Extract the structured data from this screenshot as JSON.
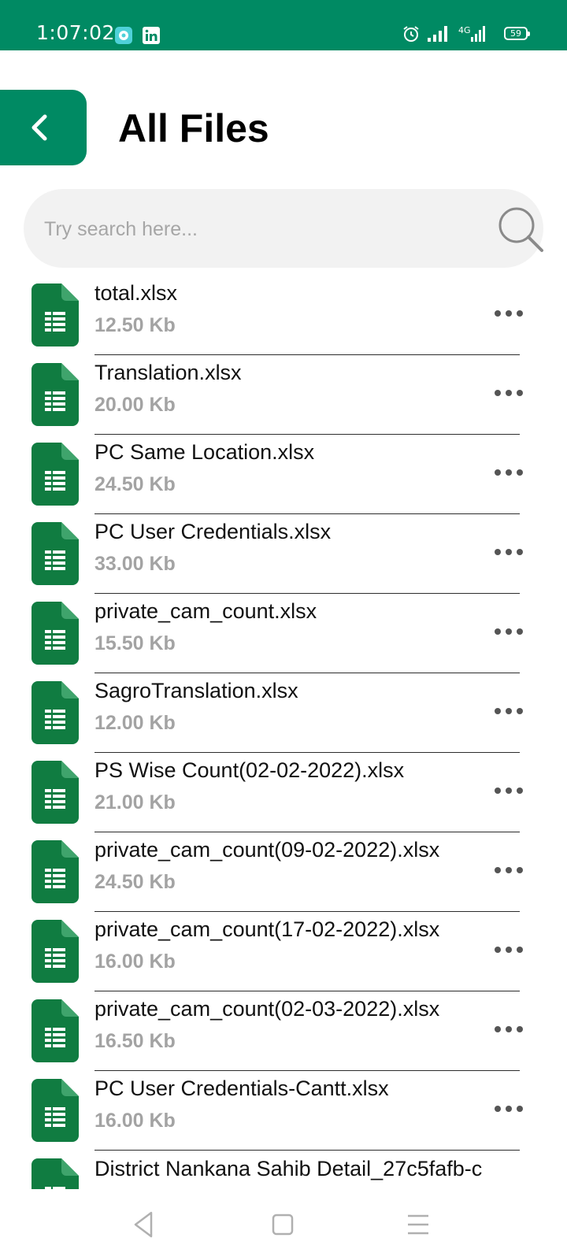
{
  "status_bar": {
    "time": "1:07:02",
    "battery": "59",
    "network": "4G"
  },
  "header": {
    "title": "All Files"
  },
  "search": {
    "placeholder": "Try search here..."
  },
  "colors": {
    "primary": "#008a63",
    "file_icon": "#107c41"
  },
  "files": [
    {
      "name": "total.xlsx",
      "size": "12.50 Kb"
    },
    {
      "name": "Translation.xlsx",
      "size": "20.00 Kb"
    },
    {
      "name": "PC Same Location.xlsx",
      "size": "24.50 Kb"
    },
    {
      "name": "PC User Credentials.xlsx",
      "size": "33.00 Kb"
    },
    {
      "name": "private_cam_count.xlsx",
      "size": "15.50 Kb"
    },
    {
      "name": "SagroTranslation.xlsx",
      "size": "12.00 Kb"
    },
    {
      "name": "PS Wise Count(02-02-2022).xlsx",
      "size": "21.00 Kb"
    },
    {
      "name": "private_cam_count(09-02-2022).xlsx",
      "size": "24.50 Kb"
    },
    {
      "name": "private_cam_count(17-02-2022).xlsx",
      "size": "16.00 Kb"
    },
    {
      "name": "private_cam_count(02-03-2022).xlsx",
      "size": "16.50 Kb"
    },
    {
      "name": "PC User Credentials-Cantt.xlsx",
      "size": "16.00 Kb"
    },
    {
      "name": "District Nankana Sahib Detail_27c5fafb-c",
      "size": ""
    }
  ]
}
